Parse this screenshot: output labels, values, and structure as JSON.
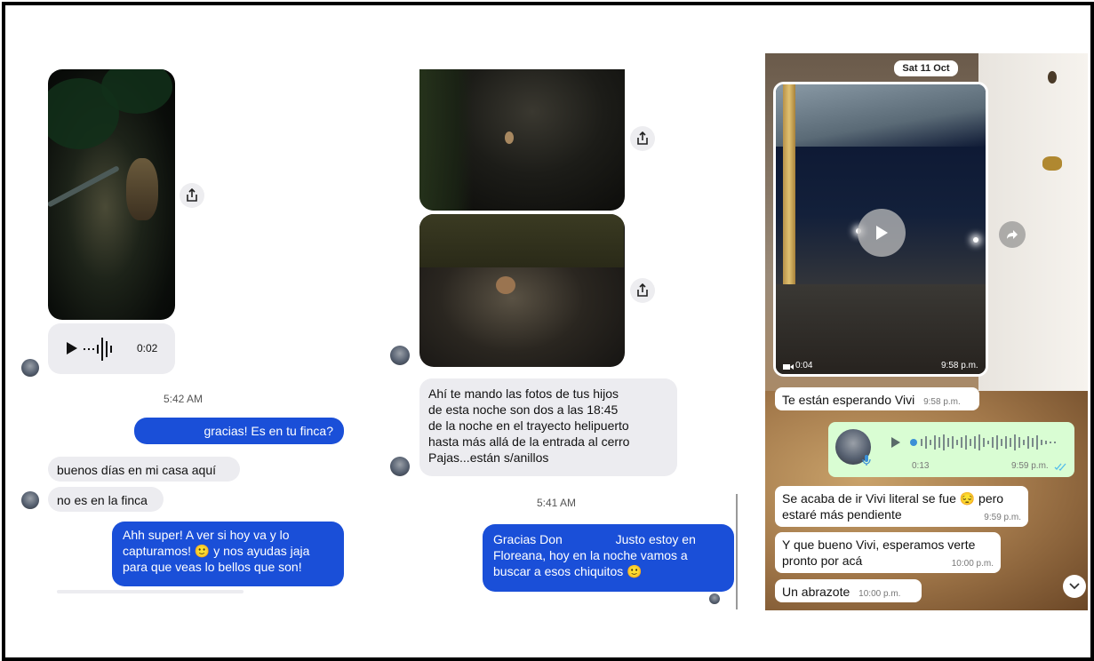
{
  "panel1": {
    "voice_duration": "0:02",
    "timestamp": "5:42 AM",
    "messages": [
      {
        "dir": "out",
        "text": "gracias! Es en tu finca?"
      },
      {
        "dir": "in",
        "text": "buenos días en mi casa aquí"
      },
      {
        "dir": "in",
        "text": "no es en la finca"
      },
      {
        "dir": "out",
        "lines": [
          "Ahh super! A ver si hoy va y lo",
          "capturamos! 🙂 y nos ayudas jaja",
          "para que veas lo bellos que son!"
        ]
      }
    ]
  },
  "panel2": {
    "incoming_lines": [
      "Ahí te mando las fotos de tus hijos",
      "de esta noche son dos a las 18:45",
      "de la noche en el trayecto helipuerto",
      "hasta más allá de la entrada al cerro",
      "Pajas...están s/anillos"
    ],
    "timestamp": "5:41 AM",
    "outgoing_lines": [
      "Gracias Don",
      "Justo estoy en",
      "Floreana, hoy en la noche vamos a",
      "buscar a esos chiquitos 🙂"
    ]
  },
  "panel3": {
    "date": "Sat 11 Oct",
    "video": {
      "duration": "0:04",
      "time": "9:58 p.m."
    },
    "messages": [
      {
        "text": "Te están esperando Vivi",
        "time": "9:58 p.m."
      },
      {
        "lines": [
          "Se acaba de ir Vivi literal se fue 😔 pero",
          "estaré más pendiente"
        ],
        "time": "9:59 p.m."
      },
      {
        "lines": [
          "Y que bueno Vivi, esperamos verte",
          "pronto por acá"
        ],
        "time": "10:00 p.m."
      },
      {
        "text": "Un abrazote",
        "time": "10:00 p.m."
      }
    ],
    "voice": {
      "duration": "0:13",
      "time": "9:59 p.m."
    }
  },
  "colors": {
    "imessage_blue": "#1a4fd8",
    "whatsapp_green": "#d9fdd3",
    "read_tick": "#53bdeb"
  },
  "icons": [
    "share-icon",
    "play-icon",
    "waveform-icon",
    "video-camera-icon",
    "forward-icon",
    "microphone-icon",
    "double-check-icon",
    "chevron-down-icon"
  ]
}
